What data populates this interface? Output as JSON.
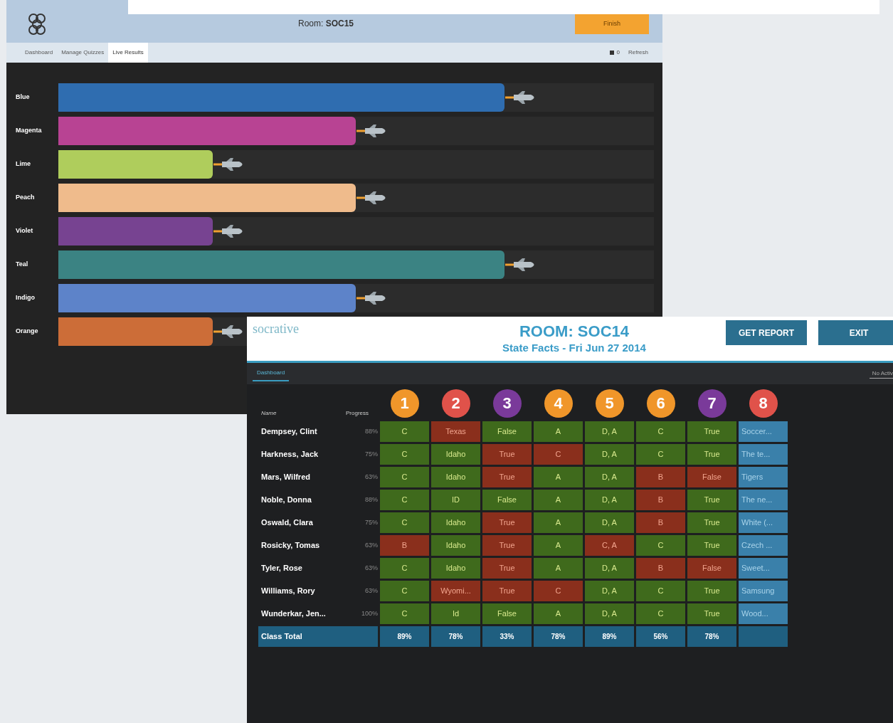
{
  "race_window": {
    "room_title": "Room: **SOC15**",
    "finish_button": "Finish",
    "nav_tabs": [
      {
        "label": "Dashboard",
        "selected": false
      },
      {
        "label": "Manage Quizzes",
        "selected": false
      },
      {
        "label": "Live Results",
        "selected": true
      }
    ],
    "count": "0",
    "refresh": "Refresh",
    "teams": [
      {
        "name": "Blue",
        "color": "#2f6db0",
        "level": 0.75
      },
      {
        "name": "Magenta",
        "color": "#b84393",
        "level": 0.5
      },
      {
        "name": "Lime",
        "color": "#afcd5c",
        "level": 0.26
      },
      {
        "name": "Peach",
        "color": "#efbb8c",
        "level": 0.5
      },
      {
        "name": "Violet",
        "color": "#774391",
        "level": 0.26
      },
      {
        "name": "Teal",
        "color": "#3b8383",
        "level": 0.75
      },
      {
        "name": "Indigo",
        "color": "#5d83c9",
        "level": 0.5
      },
      {
        "name": "Orange",
        "color": "#cc6d38",
        "level": 0.26
      }
    ]
  },
  "results_window": {
    "logo": "socrative",
    "room_title": "ROOM: SOC14",
    "subtitle": "State Facts - Fri Jun 27 2014",
    "buttons": [
      "GET REPORT",
      "EXIT"
    ],
    "tab": {
      "label": "Dashboard",
      "selected": true
    },
    "status": "No Activ",
    "columns": {
      "name": "Name",
      "progress": "Progress"
    },
    "questions": [
      {
        "number": "1",
        "color": "#f0962a"
      },
      {
        "number": "2",
        "color": "#e0524a"
      },
      {
        "number": "3",
        "color": "#7a3a9a"
      },
      {
        "number": "4",
        "color": "#f0962a"
      },
      {
        "number": "5",
        "color": "#f0962a"
      },
      {
        "number": "6",
        "color": "#f0962a"
      },
      {
        "number": "7",
        "color": "#7a3a9a"
      },
      {
        "number": "8",
        "color": "#e0524a"
      }
    ],
    "rows": [
      {
        "name": "Dempsey, Clint",
        "progress": "88%",
        "answers": [
          {
            "text": "C",
            "kind": "correct"
          },
          {
            "text": "Texas",
            "kind": "incorrect"
          },
          {
            "text": "False",
            "kind": "correct"
          },
          {
            "text": "A",
            "kind": "correct"
          },
          {
            "text": "D, A",
            "kind": "correct"
          },
          {
            "text": "C",
            "kind": "correct"
          },
          {
            "text": "True",
            "kind": "correct"
          },
          {
            "text": "Soccer...",
            "kind": "open"
          }
        ]
      },
      {
        "name": "Harkness, Jack",
        "progress": "75%",
        "answers": [
          {
            "text": "C",
            "kind": "correct"
          },
          {
            "text": "Idaho",
            "kind": "correct"
          },
          {
            "text": "True",
            "kind": "incorrect"
          },
          {
            "text": "C",
            "kind": "incorrect"
          },
          {
            "text": "D, A",
            "kind": "correct"
          },
          {
            "text": "C",
            "kind": "correct"
          },
          {
            "text": "True",
            "kind": "correct"
          },
          {
            "text": "The te...",
            "kind": "open"
          }
        ]
      },
      {
        "name": "Mars, Wilfred",
        "progress": "63%",
        "answers": [
          {
            "text": "C",
            "kind": "correct"
          },
          {
            "text": "Idaho",
            "kind": "correct"
          },
          {
            "text": "True",
            "kind": "incorrect"
          },
          {
            "text": "A",
            "kind": "correct"
          },
          {
            "text": "D, A",
            "kind": "correct"
          },
          {
            "text": "B",
            "kind": "incorrect"
          },
          {
            "text": "False",
            "kind": "incorrect"
          },
          {
            "text": "Tigers",
            "kind": "open"
          }
        ]
      },
      {
        "name": "Noble, Donna",
        "progress": "88%",
        "answers": [
          {
            "text": "C",
            "kind": "correct"
          },
          {
            "text": "ID",
            "kind": "correct"
          },
          {
            "text": "False",
            "kind": "correct"
          },
          {
            "text": "A",
            "kind": "correct"
          },
          {
            "text": "D, A",
            "kind": "correct"
          },
          {
            "text": "B",
            "kind": "incorrect"
          },
          {
            "text": "True",
            "kind": "correct"
          },
          {
            "text": "The ne...",
            "kind": "open"
          }
        ]
      },
      {
        "name": "Oswald, Clara",
        "progress": "75%",
        "answers": [
          {
            "text": "C",
            "kind": "correct"
          },
          {
            "text": "Idaho",
            "kind": "correct"
          },
          {
            "text": "True",
            "kind": "incorrect"
          },
          {
            "text": "A",
            "kind": "correct"
          },
          {
            "text": "D, A",
            "kind": "correct"
          },
          {
            "text": "B",
            "kind": "incorrect"
          },
          {
            "text": "True",
            "kind": "correct"
          },
          {
            "text": "White (...",
            "kind": "open"
          }
        ]
      },
      {
        "name": "Rosicky, Tomas",
        "progress": "63%",
        "answers": [
          {
            "text": "B",
            "kind": "incorrect"
          },
          {
            "text": "Idaho",
            "kind": "correct"
          },
          {
            "text": "True",
            "kind": "incorrect"
          },
          {
            "text": "A",
            "kind": "correct"
          },
          {
            "text": "C, A",
            "kind": "incorrect"
          },
          {
            "text": "C",
            "kind": "correct"
          },
          {
            "text": "True",
            "kind": "correct"
          },
          {
            "text": "Czech ...",
            "kind": "open"
          }
        ]
      },
      {
        "name": "Tyler, Rose",
        "progress": "63%",
        "answers": [
          {
            "text": "C",
            "kind": "correct"
          },
          {
            "text": "Idaho",
            "kind": "correct"
          },
          {
            "text": "True",
            "kind": "incorrect"
          },
          {
            "text": "A",
            "kind": "correct"
          },
          {
            "text": "D, A",
            "kind": "correct"
          },
          {
            "text": "B",
            "kind": "incorrect"
          },
          {
            "text": "False",
            "kind": "incorrect"
          },
          {
            "text": "Sweet...",
            "kind": "open"
          }
        ]
      },
      {
        "name": "Williams, Rory",
        "progress": "63%",
        "answers": [
          {
            "text": "C",
            "kind": "correct"
          },
          {
            "text": "Wyomi...",
            "kind": "incorrect"
          },
          {
            "text": "True",
            "kind": "incorrect"
          },
          {
            "text": "C",
            "kind": "incorrect"
          },
          {
            "text": "D, A",
            "kind": "correct"
          },
          {
            "text": "C",
            "kind": "correct"
          },
          {
            "text": "True",
            "kind": "correct"
          },
          {
            "text": "Samsung",
            "kind": "open"
          }
        ]
      },
      {
        "name": "Wunderkar, Jen...",
        "progress": "100%",
        "answers": [
          {
            "text": "C",
            "kind": "correct"
          },
          {
            "text": "Id",
            "kind": "correct"
          },
          {
            "text": "False",
            "kind": "correct"
          },
          {
            "text": "A",
            "kind": "correct"
          },
          {
            "text": "D, A",
            "kind": "correct"
          },
          {
            "text": "C",
            "kind": "correct"
          },
          {
            "text": "True",
            "kind": "correct"
          },
          {
            "text": "Wood...",
            "kind": "open"
          }
        ]
      }
    ],
    "total": {
      "label": "Class Total",
      "values": [
        "89%",
        "78%",
        "33%",
        "78%",
        "89%",
        "56%",
        "78%"
      ]
    }
  }
}
